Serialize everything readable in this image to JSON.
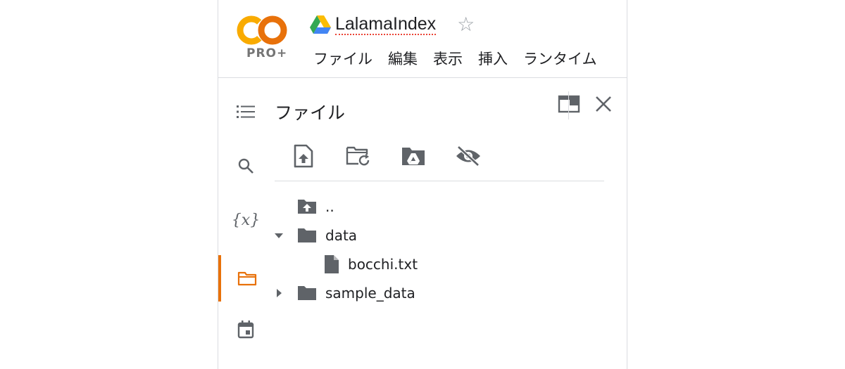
{
  "app": {
    "logo_text": "CO",
    "pro_label": "PRO+",
    "notebook_title": "LalamaIndex",
    "star_glyph": "☆",
    "accent_color": "#e8710a"
  },
  "menu": {
    "items": [
      {
        "label": "ファイル"
      },
      {
        "label": "編集"
      },
      {
        "label": "表示"
      },
      {
        "label": "挿入"
      },
      {
        "label": "ランタイム"
      }
    ]
  },
  "sidebar": {
    "items": [
      {
        "icon": "table-of-contents-icon"
      },
      {
        "icon": "search-icon"
      },
      {
        "icon": "variables-icon",
        "glyph": "{x}"
      },
      {
        "icon": "folder-icon",
        "active": true
      },
      {
        "icon": "calendar-icon"
      }
    ]
  },
  "files_panel": {
    "title": "ファイル",
    "toolbar": [
      "upload-file-icon",
      "refresh-folder-icon",
      "mount-drive-icon",
      "hide-files-icon"
    ],
    "tree": [
      {
        "name": "..",
        "type": "parent"
      },
      {
        "name": "data",
        "type": "folder",
        "expanded": true
      },
      {
        "name": "bocchi.txt",
        "type": "file"
      },
      {
        "name": "sample_data",
        "type": "folder",
        "expanded": false
      }
    ]
  }
}
